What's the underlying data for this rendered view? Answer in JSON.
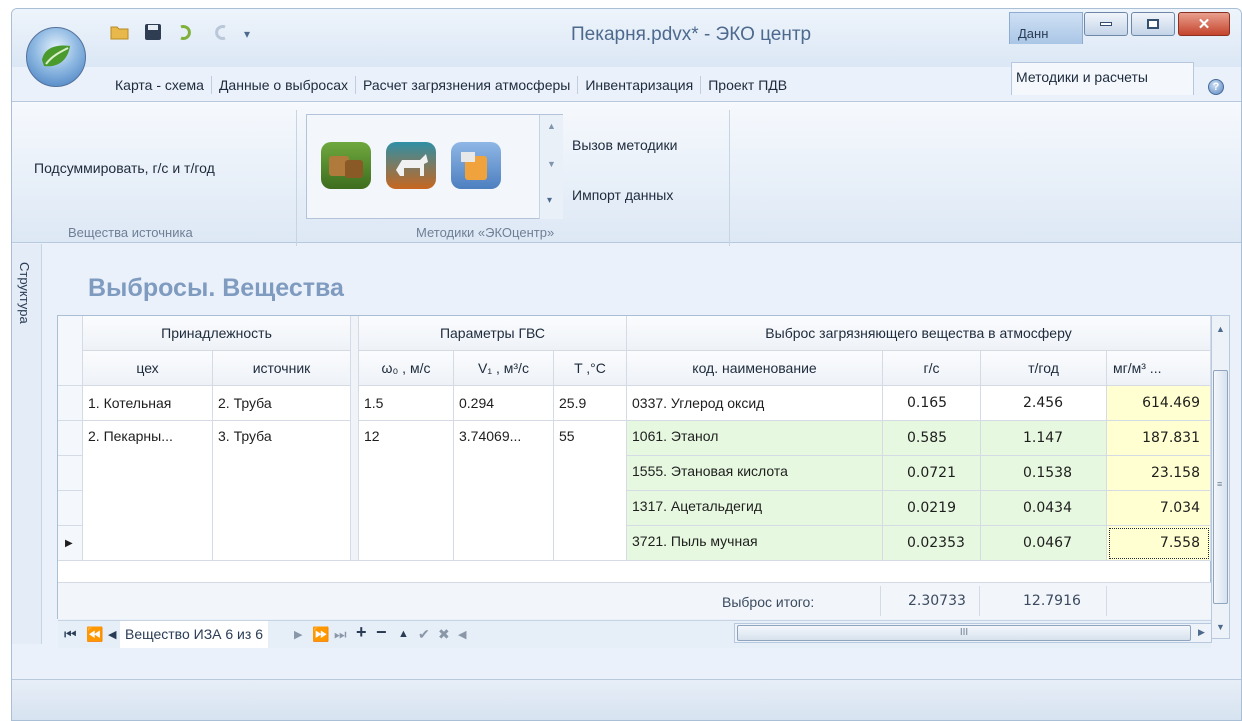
{
  "window": {
    "title": "Пекарня.pdvx* - ЭКО центр",
    "context_tab": "Данн",
    "accent": "#2c5fa3"
  },
  "tabs": [
    "Карта - схема",
    "Данные о выбросах",
    "Расчет загрязнения атмосферы",
    "Инвентаризация",
    "Проект ПДВ",
    "Методики и расчеты"
  ],
  "ribbon": {
    "sum_label": "Подсуммировать, г/с и т/год",
    "group1_caption": "Вещества источника",
    "call_method": "Вызов методики",
    "import_data": "Импорт данных",
    "group2_caption": "Методики «ЭКОцентр»"
  },
  "sidebar_label": "Структура",
  "heading": "Выбросы. Вещества",
  "grid": {
    "group_headers": [
      "Принадлежность",
      "Параметры ГВС",
      "Выброс загрязняющего вещества в атмосферу"
    ],
    "columns": [
      "цех",
      "источник",
      "ω₀ , м/с",
      "V₁ , м³/с",
      "T ,°С",
      "код. наименование",
      "г/с",
      "т/год",
      "мг/м³ ..."
    ],
    "rows": [
      {
        "ceh": "1. Котельная",
        "source": "2. Труба",
        "w": "1.5",
        "v": "0.294",
        "t": "25.9",
        "name": "0337. Углерод оксид",
        "gs": "0.165",
        "tg": "2.456",
        "mg": "614.469"
      },
      {
        "ceh": "2. Пекарны...",
        "source": "3. Труба",
        "w": "12",
        "v": "3.74069...",
        "t": "55",
        "name": "1061. Этанол",
        "gs": "0.585",
        "tg": "1.147",
        "mg": "187.831"
      },
      {
        "ceh": "",
        "source": "",
        "w": "",
        "v": "",
        "t": "",
        "name": "1555. Этановая кислота",
        "gs": "0.0721",
        "tg": "0.1538",
        "mg": "23.158"
      },
      {
        "ceh": "",
        "source": "",
        "w": "",
        "v": "",
        "t": "",
        "name": "1317. Ацетальдегид",
        "gs": "0.0219",
        "tg": "0.0434",
        "mg": "7.034"
      },
      {
        "ceh": "",
        "source": "",
        "w": "",
        "v": "",
        "t": "",
        "name": "3721. Пыль мучная",
        "gs": "0.02353",
        "tg": "0.0467",
        "mg": "7.558"
      }
    ],
    "total_label": "Выброс итого:",
    "total_gs": "2.30733",
    "total_tg": "12.7916"
  },
  "navigator": {
    "record_text": "Вещество ИЗА 6 из 6",
    "hscroll_glyph": "III"
  }
}
